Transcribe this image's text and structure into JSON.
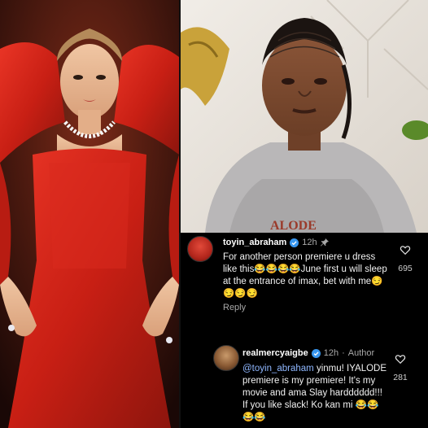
{
  "comments": [
    {
      "username": "toyin_abraham",
      "time": "12h",
      "pinned": true,
      "author_badge": "",
      "text": "For another person premiere u dress like this😂😂😂😂June first u will sleep at the entrance of imax, bet with me😏😏😏😏",
      "mention": "",
      "reply_label": "Reply",
      "likes": "695",
      "icons": [
        "verified-icon",
        "pin-icon",
        "heart-icon"
      ]
    },
    {
      "username": "realmercyaigbe",
      "time": "12h",
      "pinned": false,
      "author_badge": "Author",
      "mention": "@toyin_abraham",
      "text": " yinmu! IYALODE premiere is my premiere! It's my movie and ama Slay hardddddd!!! If you like slack! Ko kan mi 😂😂😂😂",
      "reply_label": "",
      "likes": "281",
      "icons": [
        "verified-icon",
        "heart-icon"
      ]
    }
  ],
  "separator": "·",
  "colors": {
    "background": "#000000",
    "verified": "#3897f0",
    "mention": "#8fb7ff",
    "muted": "#a8a8a8",
    "dress": "#d2271c"
  }
}
